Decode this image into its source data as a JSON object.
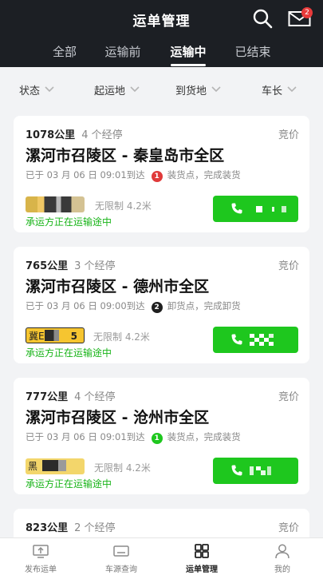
{
  "header": {
    "title": "运单管理",
    "mail_badge": "2"
  },
  "tabs": [
    {
      "label": "全部",
      "active": false
    },
    {
      "label": "运输前",
      "active": false
    },
    {
      "label": "运输中",
      "active": true
    },
    {
      "label": "已结束",
      "active": false
    }
  ],
  "filters": [
    {
      "label": "状态"
    },
    {
      "label": "起运地"
    },
    {
      "label": "到货地"
    },
    {
      "label": "车长"
    }
  ],
  "orders": [
    {
      "distance": "1078公里",
      "stops": "4 个经停",
      "price_type": "竞价",
      "route": "漯河市召陵区 - 秦皇岛市全区",
      "arrived": "已于 03 月 06 日 09:01到达",
      "stop_no": "1",
      "stop_color": "#e03a3a",
      "stop_action": "装货点，完成装货",
      "plate_prefix": "",
      "plate_suffix": "",
      "vehicle": "无限制 4.2米",
      "status": "承运方正在运输途中"
    },
    {
      "distance": "765公里",
      "stops": "3 个经停",
      "price_type": "竞价",
      "route": "漯河市召陵区 - 德州市全区",
      "arrived": "已于 03 月 06 日 09:00到达",
      "stop_no": "2",
      "stop_color": "#1f1f1f",
      "stop_action": "卸货点，完成卸货",
      "plate_prefix": "冀E",
      "plate_suffix": "5",
      "vehicle": "无限制 4.2米",
      "status": "承运方正在运输途中"
    },
    {
      "distance": "777公里",
      "stops": "4 个经停",
      "price_type": "竞价",
      "route": "漯河市召陵区 - 沧州市全区",
      "arrived": "已于 03 月 06 日 09:01到达",
      "stop_no": "1",
      "stop_color": "#1ec71e",
      "stop_action": "装货点，完成装货",
      "plate_prefix": "黑",
      "plate_suffix": "",
      "vehicle": "无限制 4.2米",
      "status": "承运方正在运输途中"
    },
    {
      "distance": "823公里",
      "stops": "2 个经停",
      "price_type": "竞价"
    }
  ],
  "bottom_nav": [
    {
      "label": "发布运单",
      "icon": "publish-icon",
      "active": false
    },
    {
      "label": "车源查询",
      "icon": "vehicle-search-icon",
      "active": false
    },
    {
      "label": "运单管理",
      "icon": "grid-icon",
      "active": true
    },
    {
      "label": "我的",
      "icon": "user-icon",
      "active": false
    }
  ],
  "colors": {
    "accent_green": "#1ec71e",
    "dark_header": "#1c1f24"
  }
}
